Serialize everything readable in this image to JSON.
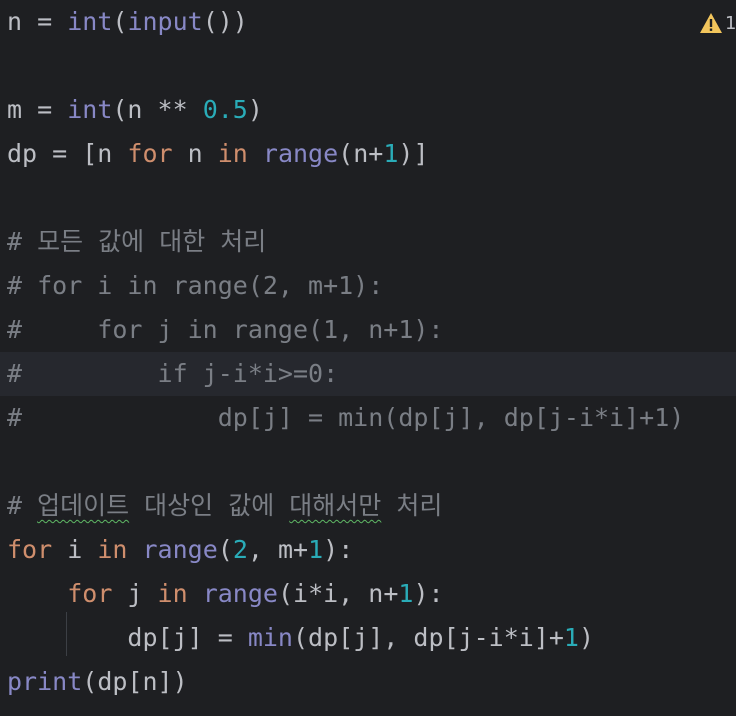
{
  "editor": {
    "warning_count": "1",
    "warning_color": "#f2c55c",
    "code": {
      "l1": {
        "a": "n = ",
        "b": "int",
        "c": "(",
        "d": "input",
        "e": "())"
      },
      "l3": {
        "a": "m = ",
        "b": "int",
        "c": "(n ** ",
        "d": "0.5",
        "e": ")"
      },
      "l4": {
        "a": "dp = [n ",
        "b": "for",
        "c": " n ",
        "d": "in",
        "e": " ",
        "f": "range",
        "g": "(n+",
        "h": "1",
        "i": ")]"
      },
      "l6": "# 모든 값에 대한 처리",
      "l7": "# for i in range(2, m+1):",
      "l8": "#     for j in range(1, n+1):",
      "l9": "#         if j-i*i>=0:",
      "l10": "#             dp[j] = min(dp[j], dp[j-i*i]+1)",
      "l12": {
        "a": "# ",
        "b": "업데이트",
        "c": " 대상인 값에 ",
        "d": "대해서만",
        "e": " 처리"
      },
      "l13": {
        "a": "for",
        "b": " i ",
        "c": "in",
        "d": " ",
        "e": "range",
        "f": "(",
        "g": "2",
        "h": ", m+",
        "i": "1",
        "j": "):"
      },
      "l14": {
        "a": "    ",
        "b": "for",
        "c": " j ",
        "d": "in",
        "e": " ",
        "f": "range",
        "g": "(i*i, n+",
        "h": "1",
        "i": "):"
      },
      "l15": {
        "a": "        dp[j] = ",
        "b": "min",
        "c": "(dp[j], dp[j-i*i]+",
        "d": "1",
        "e": ")"
      },
      "l16": {
        "a": "print",
        "b": "(dp[n])"
      }
    }
  }
}
